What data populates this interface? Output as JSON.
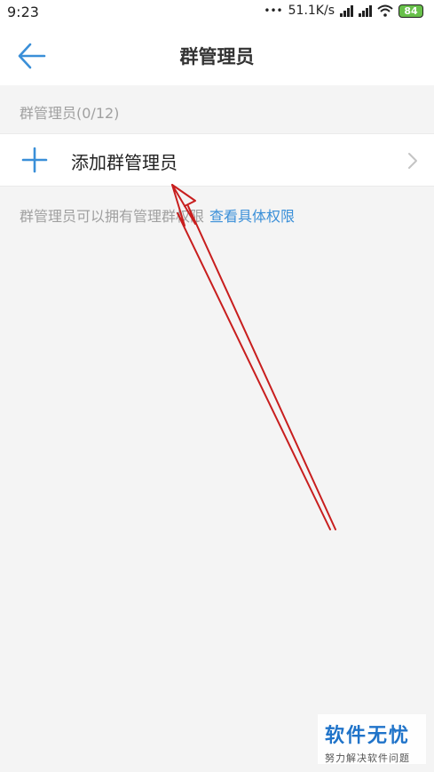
{
  "status_bar": {
    "time": "9:23",
    "network_speed": "51.1K/s",
    "battery": "84"
  },
  "nav": {
    "title": "群管理员"
  },
  "section": {
    "label": "群管理员(0/12)"
  },
  "add_row": {
    "label": "添加群管理员"
  },
  "hint": {
    "text": "群管理员可以拥有管理群权限",
    "link": "查看具体权限"
  },
  "watermark": {
    "title": "软件无忧",
    "subtitle": "努力解决软件问题"
  },
  "colors": {
    "accent": "#3a8fd8",
    "annotation": "#c81e1e",
    "background": "#f4f4f4",
    "battery": "#68c04a"
  },
  "icons": {
    "back": "arrow-left-icon",
    "add": "plus-icon",
    "chevron": "chevron-right-icon",
    "wifi": "wifi-icon",
    "signal": "signal-icon"
  }
}
